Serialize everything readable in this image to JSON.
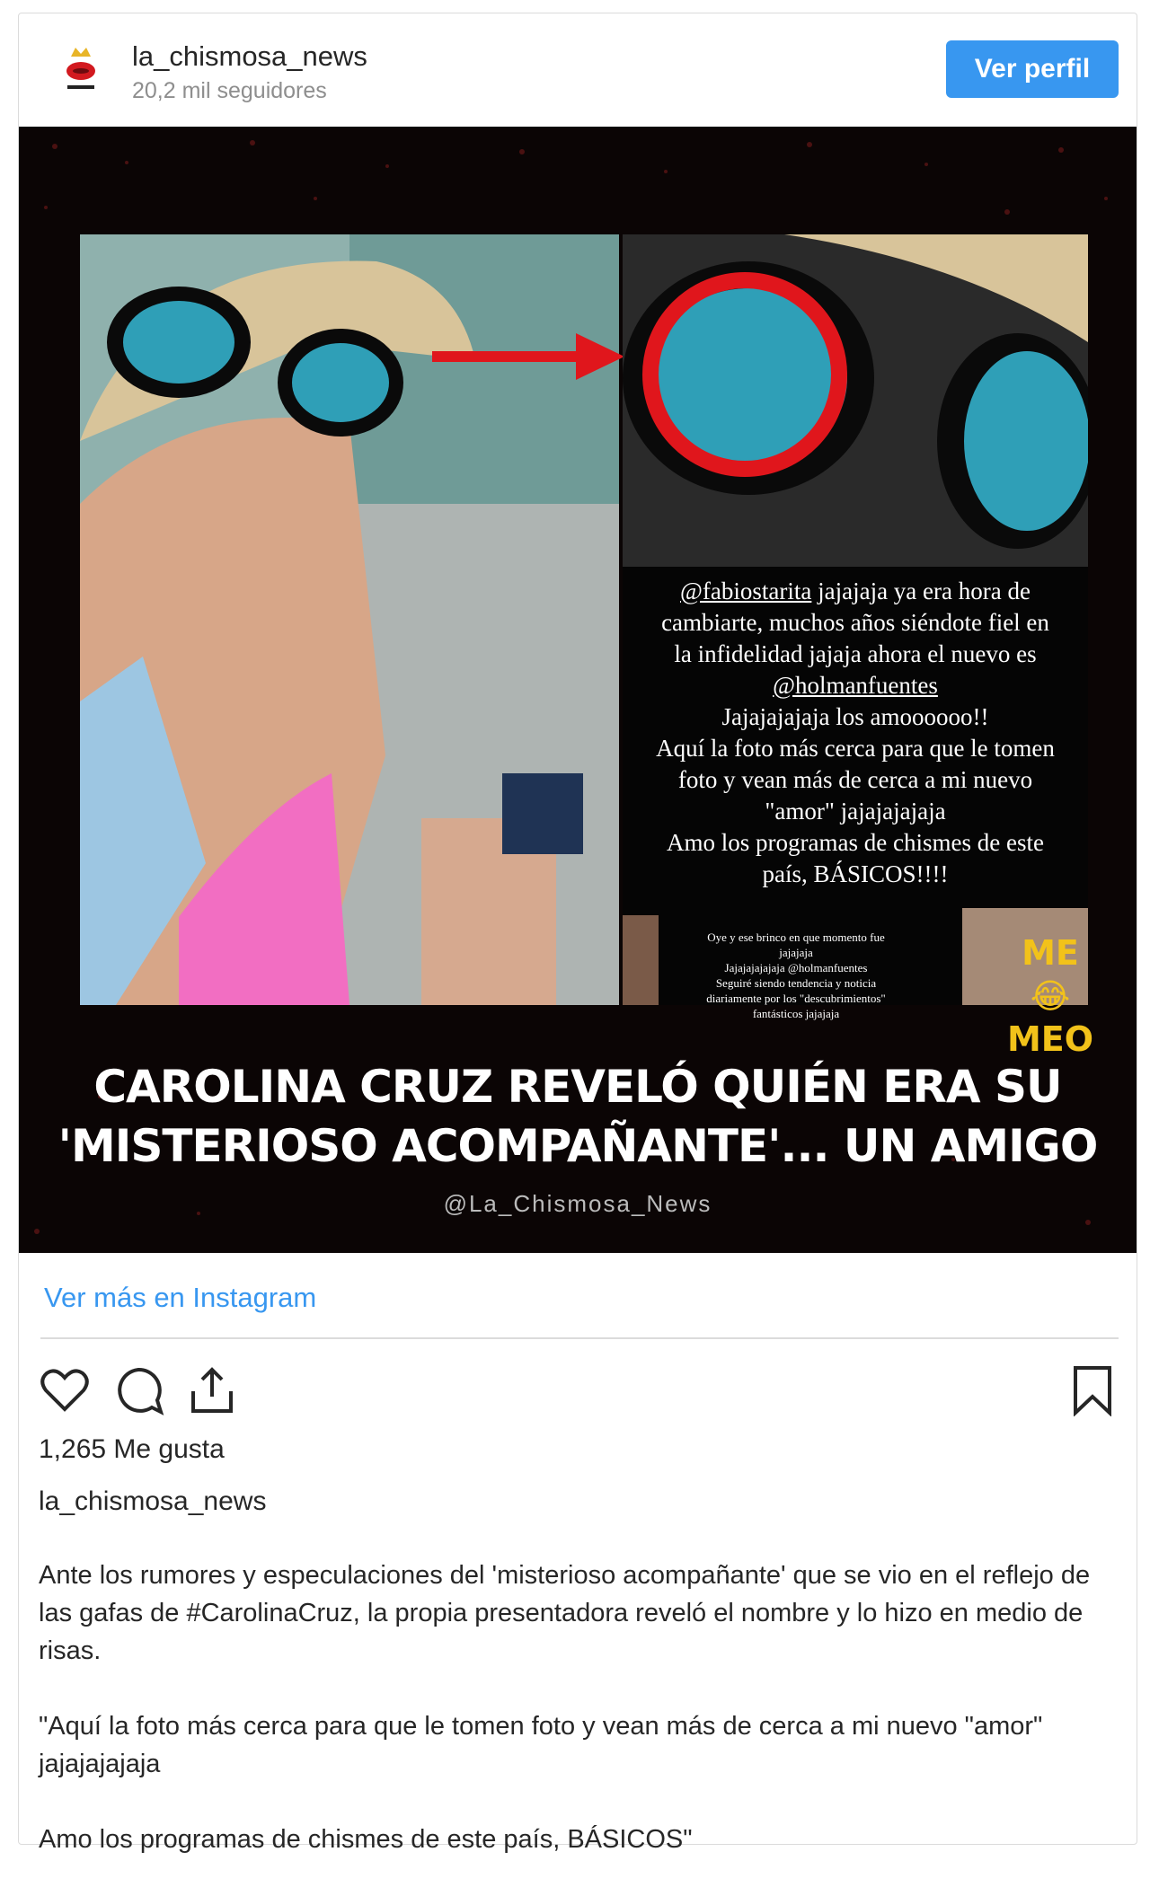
{
  "header": {
    "username": "la_chismosa_news",
    "followers": "20,2 mil seguidores",
    "view_profile_button": "Ver perfil"
  },
  "media": {
    "story_lines": [
      {
        "text": "@fabiostarita",
        "underline": true,
        "inline_next": true
      },
      {
        "text": " jajajaja ya era hora de",
        "underline": false
      },
      {
        "text": "cambiarte, muchos años siéndote fiel en",
        "underline": false
      },
      {
        "text": "la infidelidad jajaja ahora el nuevo es",
        "underline": false
      },
      {
        "text": "@holmanfuentes",
        "underline": true
      },
      {
        "text": "Jajajajajaja los amoooooo!!",
        "underline": false
      },
      {
        "text": "Aquí la foto más cerca para que le tomen",
        "underline": false
      },
      {
        "text": "foto y vean más  de cerca a mi nuevo",
        "underline": false
      },
      {
        "text": "\"amor\" jajajajajaja",
        "underline": false
      },
      {
        "text": "Amo los programas de chismes de este",
        "underline": false
      },
      {
        "text": "país, BÁSICOS!!!!",
        "underline": false
      }
    ],
    "small_story_lines": [
      "Oye y ese brinco en que momento fue",
      "jajajaja",
      "Jajajajajajaja @holmanfuentes",
      "Seguiré siendo tendencia y noticia",
      "diariamente por los \"descubrimientos\"",
      "fantásticos jajajaja"
    ],
    "sticker_text": [
      "ME",
      "MEO"
    ],
    "headline_line1": "CAROLINA CRUZ REVELÓ QUIÉN ERA SU",
    "headline_line2": "'MISTERIOSO ACOMPAÑANTE'... UN AMIGO",
    "watermark": "@La_Chismosa_News",
    "colors": {
      "arrow": "#e0161c",
      "circle": "#e0161c",
      "background": "#0b0505"
    }
  },
  "ver_mas_link": "Ver más en Instagram",
  "actions": {
    "icons": [
      "heart-icon",
      "comment-icon",
      "share-icon",
      "bookmark-icon"
    ]
  },
  "likes": "1,265 Me gusta",
  "caption_owner": "la_chismosa_news",
  "caption": {
    "p1": "Ante los rumores y especulaciones del 'misterioso acompañante' que se vio en el reflejo de las gafas de #CarolinaCruz, la propia presentadora reveló el nombre y lo hizo en medio de risas.",
    "p2": "\"Aquí la foto más cerca para que le tomen foto y vean más de cerca a mi nuevo \"amor\" jajajajajaja",
    "p3": "Amo los programas de chismes de este país, BÁSICOS\""
  }
}
